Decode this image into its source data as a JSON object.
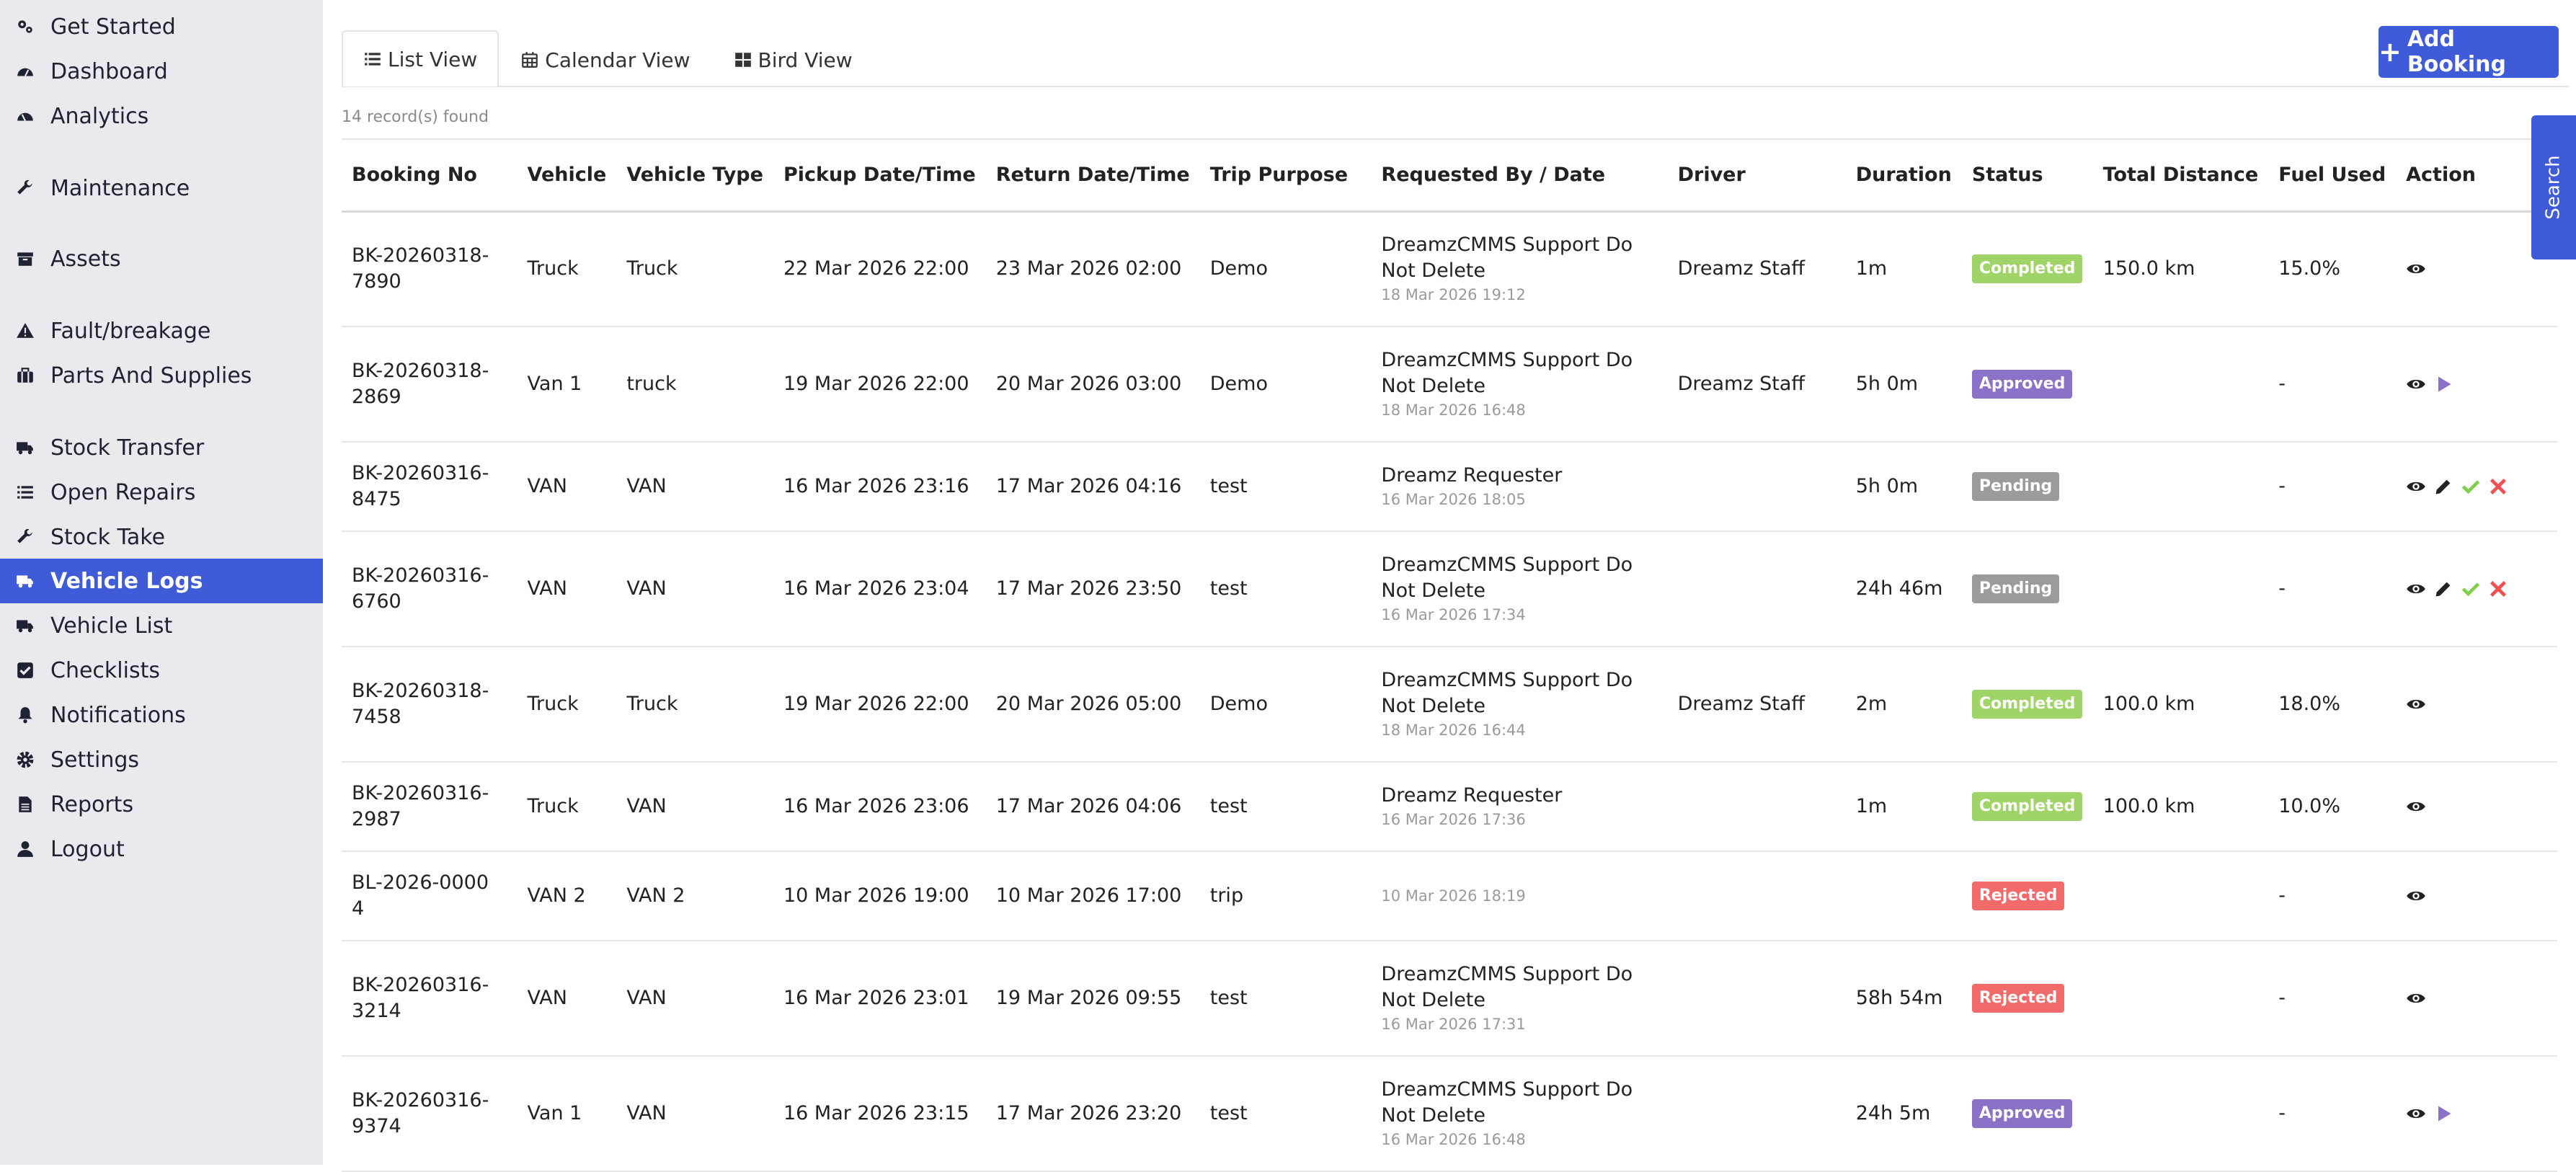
{
  "sidebar": {
    "items": [
      {
        "label": "Get Started",
        "icon": "gears-icon"
      },
      {
        "label": "Dashboard",
        "icon": "dashboard-gauge-icon"
      },
      {
        "label": "Analytics",
        "icon": "analytics-gauge-icon"
      },
      {
        "label": "Maintenance",
        "icon": "wrench-icon"
      },
      {
        "label": "Assets",
        "icon": "archive-box-icon"
      },
      {
        "label": "Fault/breakage",
        "icon": "warning-triangle-icon"
      },
      {
        "label": "Parts And Supplies",
        "icon": "briefcase-icon"
      },
      {
        "label": "Stock Transfer",
        "icon": "truck-icon"
      },
      {
        "label": "Open Repairs",
        "icon": "list-icon"
      },
      {
        "label": "Stock Take",
        "icon": "wrench-icon"
      },
      {
        "label": "Vehicle Logs",
        "icon": "truck-icon"
      },
      {
        "label": "Vehicle List",
        "icon": "truck-icon"
      },
      {
        "label": "Checklists",
        "icon": "checkbox-icon"
      },
      {
        "label": "Notifications",
        "icon": "bell-icon"
      },
      {
        "label": "Settings",
        "icon": "gear-icon"
      },
      {
        "label": "Reports",
        "icon": "file-icon"
      },
      {
        "label": "Logout",
        "icon": "user-icon"
      }
    ]
  },
  "tabs": {
    "list": "List View",
    "calendar": "Calendar View",
    "bird": "Bird View"
  },
  "add_booking": "Add Booking",
  "search_label": "Search",
  "records_found": "14 record(s) found",
  "colors": {
    "accent": "#3f5bd8",
    "completed": "#a0d468",
    "approved": "#8a72c8",
    "pending": "#9b9b9b",
    "rejected": "#f26a6a"
  },
  "table": {
    "headers": [
      "Booking No",
      "Vehicle",
      "Vehicle Type",
      "Pickup Date/Time",
      "Return Date/Time",
      "Trip Purpose",
      "Requested By / Date",
      "Driver",
      "Duration",
      "Status",
      "Total Distance",
      "Fuel Used",
      "Action"
    ],
    "rows": [
      {
        "booking": "BK-20260318-7890",
        "vehicle": "Truck",
        "type": "Truck",
        "pickup": "22 Mar 2026 22:00",
        "return": "23 Mar 2026 02:00",
        "purpose": "Demo",
        "requested": "DreamzCMMS Support Do Not Delete",
        "req_date": "18 Mar 2026 19:12",
        "driver": "Dreamz Staff",
        "duration": "1m",
        "status": "Completed",
        "distance": "150.0 km",
        "fuel": "15.0%",
        "actions": [
          "view"
        ]
      },
      {
        "booking": "BK-20260318-2869",
        "vehicle": "Van 1",
        "type": "truck",
        "pickup": "19 Mar 2026 22:00",
        "return": "20 Mar 2026 03:00",
        "purpose": "Demo",
        "requested": "DreamzCMMS Support Do Not Delete",
        "req_date": "18 Mar 2026 16:48",
        "driver": "Dreamz Staff",
        "duration": "5h 0m",
        "status": "Approved",
        "distance": "",
        "fuel": "-",
        "actions": [
          "view",
          "start"
        ]
      },
      {
        "booking": "BK-20260316-8475",
        "vehicle": "VAN",
        "type": "VAN",
        "pickup": "16 Mar 2026 23:16",
        "return": "17 Mar 2026 04:16",
        "purpose": "test",
        "requested": "Dreamz Requester",
        "req_date": "16 Mar 2026 18:05",
        "driver": "",
        "duration": "5h 0m",
        "status": "Pending",
        "distance": "",
        "fuel": "-",
        "actions": [
          "view",
          "edit",
          "approve",
          "reject"
        ]
      },
      {
        "booking": "BK-20260316-6760",
        "vehicle": "VAN",
        "type": "VAN",
        "pickup": "16 Mar 2026 23:04",
        "return": "17 Mar 2026 23:50",
        "purpose": "test",
        "requested": "DreamzCMMS Support Do Not Delete",
        "req_date": "16 Mar 2026 17:34",
        "driver": "",
        "duration": "24h 46m",
        "status": "Pending",
        "distance": "",
        "fuel": "-",
        "actions": [
          "view",
          "edit",
          "approve",
          "reject"
        ]
      },
      {
        "booking": "BK-20260318-7458",
        "vehicle": "Truck",
        "type": "Truck",
        "pickup": "19 Mar 2026 22:00",
        "return": "20 Mar 2026 05:00",
        "purpose": "Demo",
        "requested": "DreamzCMMS Support Do Not Delete",
        "req_date": "18 Mar 2026 16:44",
        "driver": "Dreamz Staff",
        "duration": "2m",
        "status": "Completed",
        "distance": "100.0 km",
        "fuel": "18.0%",
        "actions": [
          "view"
        ]
      },
      {
        "booking": "BK-20260316-2987",
        "vehicle": "Truck",
        "type": "VAN",
        "pickup": "16 Mar 2026 23:06",
        "return": "17 Mar 2026 04:06",
        "purpose": "test",
        "requested": "Dreamz Requester",
        "req_date": "16 Mar 2026 17:36",
        "driver": "",
        "duration": "1m",
        "status": "Completed",
        "distance": "100.0 km",
        "fuel": "10.0%",
        "actions": [
          "view"
        ]
      },
      {
        "booking": "BL-2026-00004",
        "vehicle": "VAN 2",
        "type": "VAN 2",
        "pickup": "10 Mar 2026 19:00",
        "return": "10 Mar 2026 17:00",
        "purpose": "trip",
        "requested": "",
        "req_date": "10 Mar 2026 18:19",
        "driver": "",
        "duration": "",
        "status": "Rejected",
        "distance": "",
        "fuel": "-",
        "actions": [
          "view"
        ]
      },
      {
        "booking": "BK-20260316-3214",
        "vehicle": "VAN",
        "type": "VAN",
        "pickup": "16 Mar 2026 23:01",
        "return": "19 Mar 2026 09:55",
        "purpose": "test",
        "requested": "DreamzCMMS Support Do Not Delete",
        "req_date": "16 Mar 2026 17:31",
        "driver": "",
        "duration": "58h 54m",
        "status": "Rejected",
        "distance": "",
        "fuel": "-",
        "actions": [
          "view"
        ]
      },
      {
        "booking": "BK-20260316-9374",
        "vehicle": "Van 1",
        "type": "VAN",
        "pickup": "16 Mar 2026 23:15",
        "return": "17 Mar 2026 23:20",
        "purpose": "test",
        "requested": "DreamzCMMS Support Do Not Delete",
        "req_date": "16 Mar 2026 16:48",
        "driver": "",
        "duration": "24h 5m",
        "status": "Approved",
        "distance": "",
        "fuel": "-",
        "actions": [
          "view",
          "start"
        ]
      }
    ]
  }
}
